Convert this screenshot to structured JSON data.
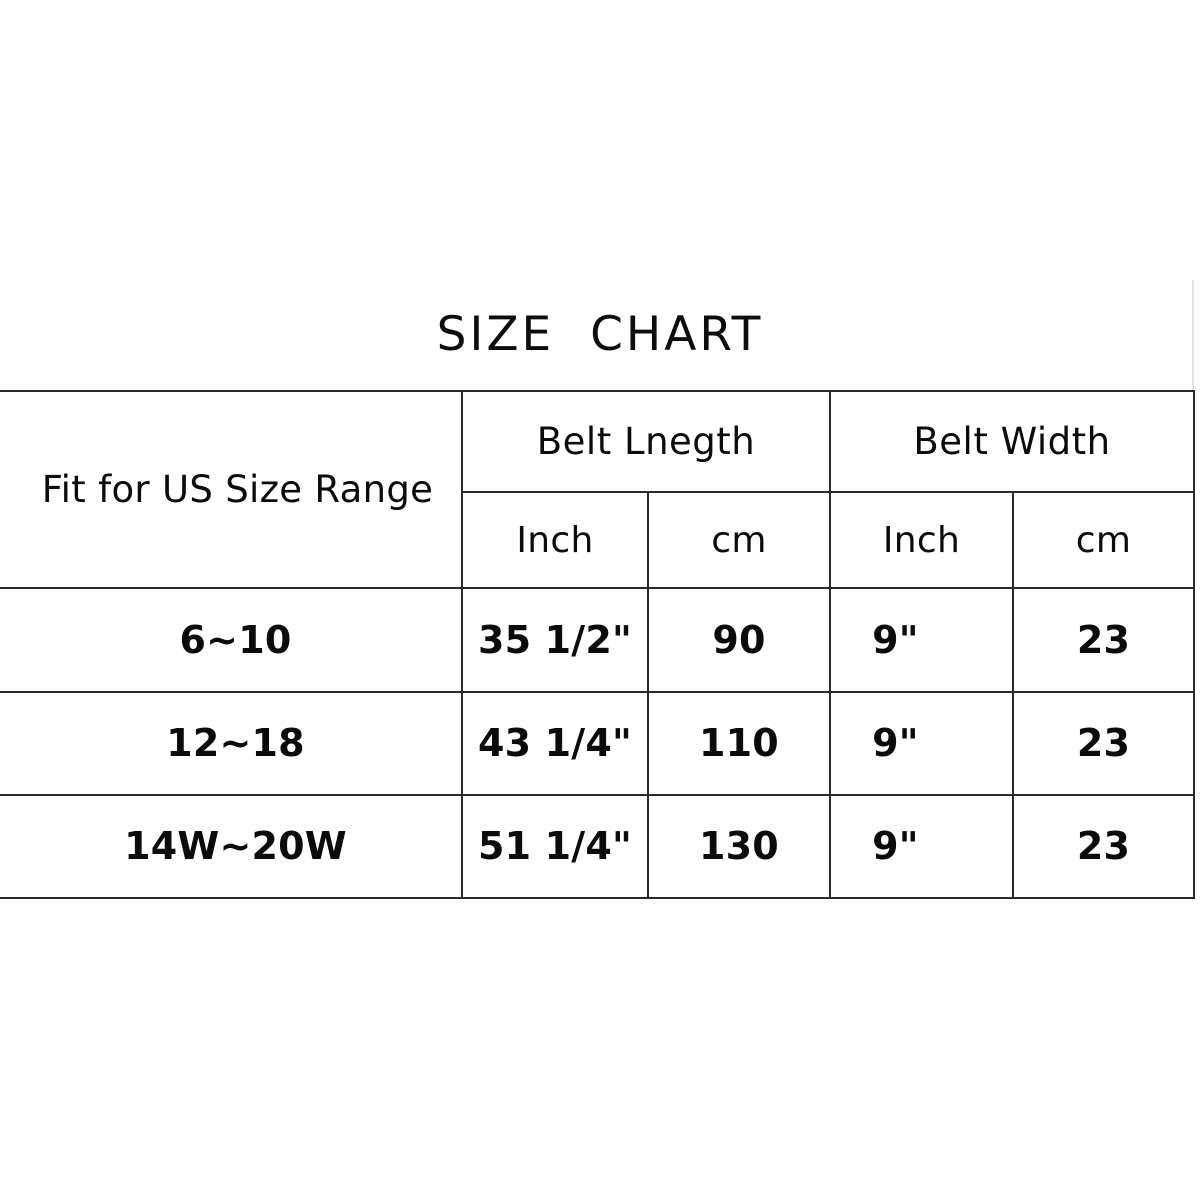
{
  "title": "SIZE  CHART",
  "table": {
    "group_headers": {
      "size_range": "Fit for US Size Range",
      "belt_length": "Belt Lnegth",
      "belt_width": "Belt Width"
    },
    "unit_headers": {
      "length_inch": "Inch",
      "length_cm": "cm",
      "width_inch": "Inch",
      "width_cm": "cm"
    },
    "rows": [
      {
        "size_range": "6~10",
        "length_inch": "35 1/2\"",
        "length_cm": "90",
        "width_inch": "9\"",
        "width_cm": "23"
      },
      {
        "size_range": "12~18",
        "length_inch": "43 1/4\"",
        "length_cm": "110",
        "width_inch": "9\"",
        "width_cm": "23"
      },
      {
        "size_range": "14W~20W",
        "length_inch": "51 1/4\"",
        "length_cm": "130",
        "width_inch": "9\"",
        "width_cm": "23"
      }
    ]
  },
  "colors": {
    "text": "#0b0b0b",
    "border": "#2b2b2b",
    "background": "#ffffff",
    "guide": "#e2e2e2"
  }
}
